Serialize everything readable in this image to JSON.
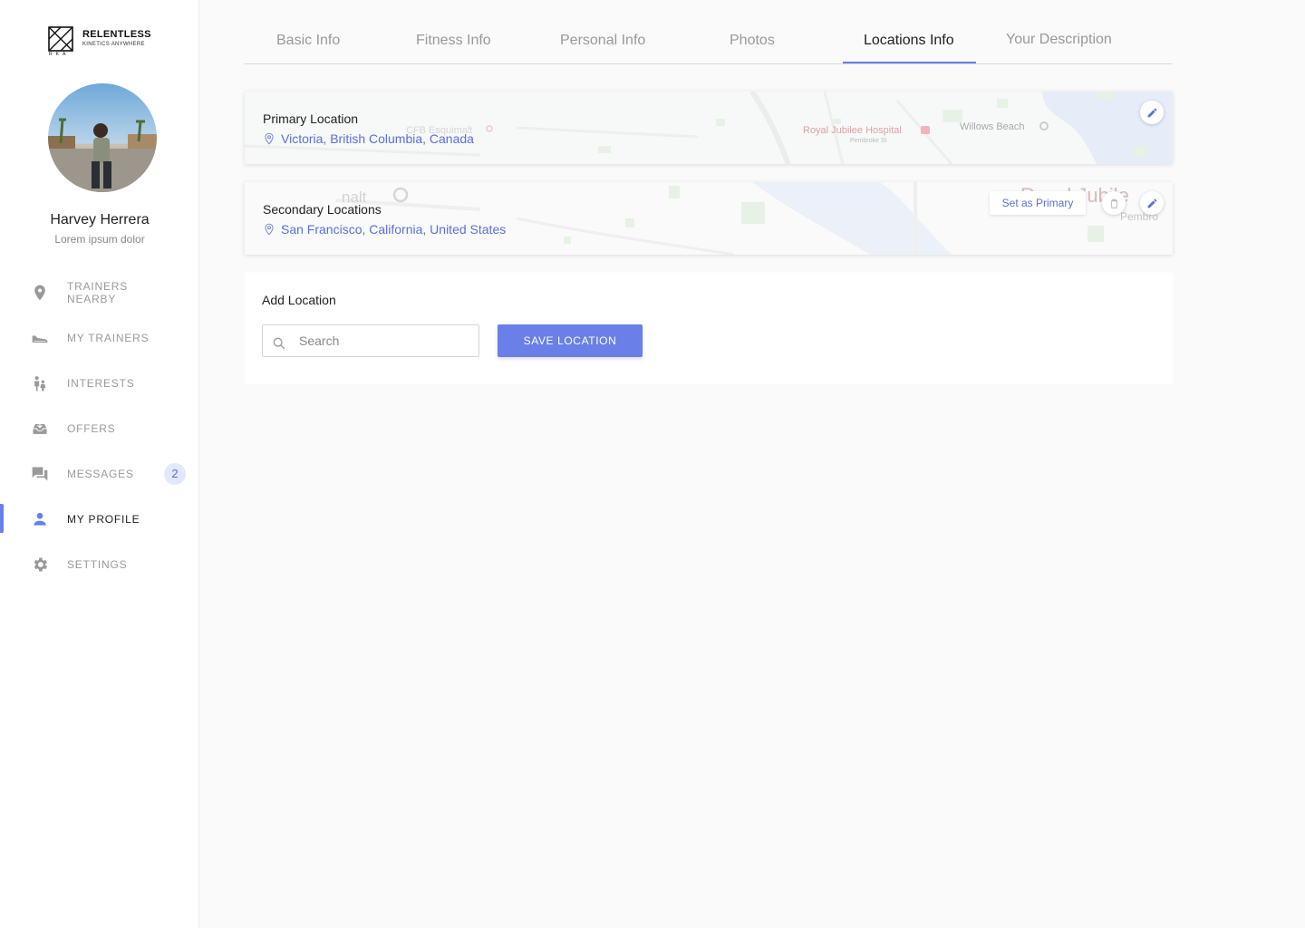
{
  "brand": {
    "name": "RELENTLESS",
    "tagline": "KINETICS ANYWHERE",
    "mark_letters": "R K A"
  },
  "user": {
    "name": "Harvey Herrera",
    "subtitle": "Lorem ipsum dolor"
  },
  "nav": [
    {
      "label": "TRAINERS",
      "label2": "NEARBY",
      "icon": "location-pin-icon"
    },
    {
      "label": "MY TRAINERS",
      "icon": "sneaker-icon"
    },
    {
      "label": "INTERESTS",
      "icon": "people-icon"
    },
    {
      "label": "OFFERS",
      "icon": "inbox-tray-icon"
    },
    {
      "label": "MESSAGES",
      "icon": "chat-icon",
      "badge": "2"
    },
    {
      "label": "MY PROFILE",
      "icon": "person-icon",
      "active": true
    },
    {
      "label": "SETTINGS",
      "icon": "gear-icon"
    }
  ],
  "tabs": [
    "Basic Info",
    "Fitness Info",
    "Personal Info",
    "Photos",
    "Locations Info",
    "Your Description"
  ],
  "active_tab": "Locations Info",
  "primary": {
    "title": "Primary Location",
    "location": "Victoria, British Columbia, Canada",
    "map_labels": {
      "hospital": "Royal Jubilee Hospital",
      "street": "Pembroke St",
      "beach": "Willows Beach",
      "poi": "CFB Esquimalt"
    }
  },
  "secondary": {
    "title": "Secondary Locations",
    "location": "San Francisco, California, United States",
    "set_primary": "Set as Primary",
    "map_labels": {
      "left": "nalt",
      "right": "Royal Jubile",
      "right2": "Pembro"
    }
  },
  "add": {
    "title": "Add Location",
    "search_placeholder": "Search",
    "save_label": "SAVE LOCATION"
  },
  "colors": {
    "accent": "#6a7fe8",
    "link": "#5b6fd9",
    "badge_bg": "#e3e8fb"
  }
}
